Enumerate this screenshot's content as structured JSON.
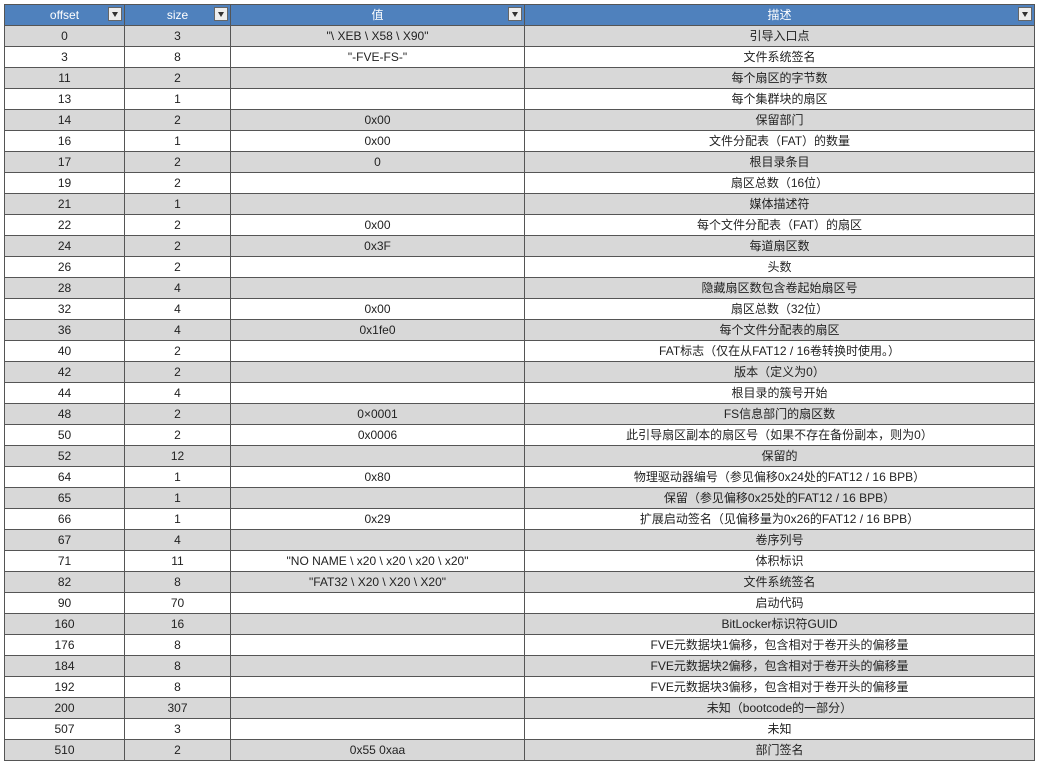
{
  "columns": [
    "offset",
    "size",
    "值",
    "描述"
  ],
  "rows": [
    {
      "offset": "0",
      "size": "3",
      "val": "\"\\ XEB \\ X58 \\ X90\"",
      "desc": "引导入口点"
    },
    {
      "offset": "3",
      "size": "8",
      "val": "\"-FVE-FS-\"",
      "desc": "文件系统签名"
    },
    {
      "offset": "11",
      "size": "2",
      "val": "",
      "desc": "每个扇区的字节数"
    },
    {
      "offset": "13",
      "size": "1",
      "val": "",
      "desc": "每个集群块的扇区"
    },
    {
      "offset": "14",
      "size": "2",
      "val": "0x00",
      "desc": "保留部门"
    },
    {
      "offset": "16",
      "size": "1",
      "val": "0x00",
      "desc": "文件分配表（FAT）的数量"
    },
    {
      "offset": "17",
      "size": "2",
      "val": "0",
      "desc": "根目录条目"
    },
    {
      "offset": "19",
      "size": "2",
      "val": "",
      "desc": "扇区总数（16位）"
    },
    {
      "offset": "21",
      "size": "1",
      "val": "",
      "desc": "媒体描述符"
    },
    {
      "offset": "22",
      "size": "2",
      "val": "0x00",
      "desc": "每个文件分配表（FAT）的扇区"
    },
    {
      "offset": "24",
      "size": "2",
      "val": "0x3F",
      "desc": "每道扇区数"
    },
    {
      "offset": "26",
      "size": "2",
      "val": "",
      "desc": "头数"
    },
    {
      "offset": "28",
      "size": "4",
      "val": "",
      "desc": "隐藏扇区数包含卷起始扇区号"
    },
    {
      "offset": "32",
      "size": "4",
      "val": "0x00",
      "desc": "扇区总数（32位）"
    },
    {
      "offset": "36",
      "size": "4",
      "val": "0x1fe0",
      "desc": "每个文件分配表的扇区"
    },
    {
      "offset": "40",
      "size": "2",
      "val": "",
      "desc": "FAT标志（仅在从FAT12 / 16卷转换时使用。）"
    },
    {
      "offset": "42",
      "size": "2",
      "val": "",
      "desc": "版本（定义为0）"
    },
    {
      "offset": "44",
      "size": "4",
      "val": "",
      "desc": "根目录的簇号开始"
    },
    {
      "offset": "48",
      "size": "2",
      "val": "0×0001",
      "desc": "FS信息部门的扇区数"
    },
    {
      "offset": "50",
      "size": "2",
      "val": "0x0006",
      "desc": "此引导扇区副本的扇区号（如果不存在备份副本，则为0）"
    },
    {
      "offset": "52",
      "size": "12",
      "val": "",
      "desc": "保留的"
    },
    {
      "offset": "64",
      "size": "1",
      "val": "0x80",
      "desc": "物理驱动器编号（参见偏移0x24处的FAT12 / 16 BPB）"
    },
    {
      "offset": "65",
      "size": "1",
      "val": "",
      "desc": "保留（参见偏移0x25处的FAT12 / 16 BPB）"
    },
    {
      "offset": "66",
      "size": "1",
      "val": "0x29",
      "desc": "扩展启动签名（见偏移量为0x26的FAT12 / 16 BPB）"
    },
    {
      "offset": "67",
      "size": "4",
      "val": "",
      "desc": "卷序列号"
    },
    {
      "offset": "71",
      "size": "11",
      "val": "\"NO NAME \\ x20 \\ x20 \\ x20 \\ x20\"",
      "desc": "体积标识"
    },
    {
      "offset": "82",
      "size": "8",
      "val": "\"FAT32 \\ X20 \\ X20 \\ X20\"",
      "desc": "文件系统签名"
    },
    {
      "offset": "90",
      "size": "70",
      "val": "",
      "desc": "启动代码"
    },
    {
      "offset": "160",
      "size": "16",
      "val": "",
      "desc": "BitLocker标识符GUID"
    },
    {
      "offset": "176",
      "size": "8",
      "val": "",
      "desc": "FVE元数据块1偏移，包含相对于卷开头的偏移量"
    },
    {
      "offset": "184",
      "size": "8",
      "val": "",
      "desc": "FVE元数据块2偏移，包含相对于卷开头的偏移量"
    },
    {
      "offset": "192",
      "size": "8",
      "val": "",
      "desc": "FVE元数据块3偏移，包含相对于卷开头的偏移量"
    },
    {
      "offset": "200",
      "size": "307",
      "val": "",
      "desc": "未知（bootcode的一部分）"
    },
    {
      "offset": "507",
      "size": "3",
      "val": "",
      "desc": "未知"
    },
    {
      "offset": "510",
      "size": "2",
      "val": "0x55 0xaa",
      "desc": "部门签名"
    }
  ]
}
